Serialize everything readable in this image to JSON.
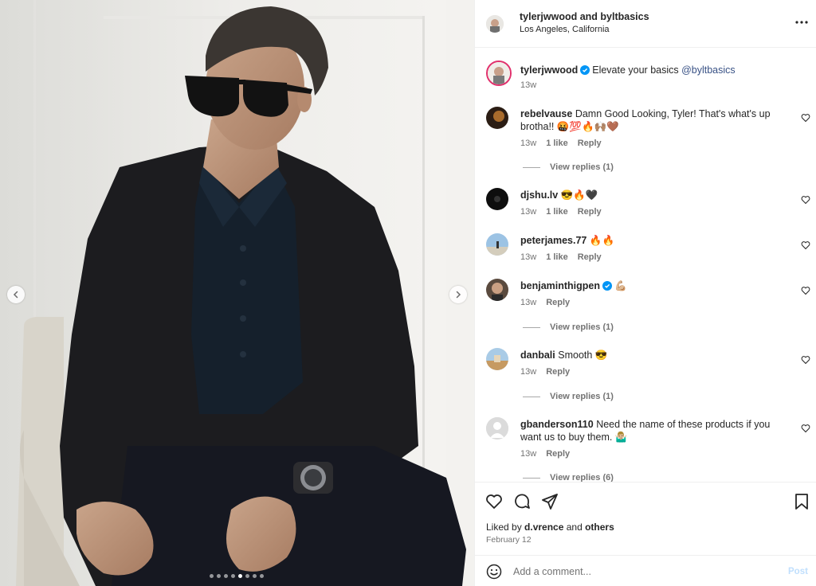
{
  "post": {
    "header": {
      "names": "tylerjwwood and byltbasics",
      "location": "Los Angeles, California"
    },
    "caption": {
      "user": "tylerjwwood",
      "text": "Elevate your basics ",
      "mention": "@byltbasics",
      "time": "13w"
    },
    "comments": [
      {
        "user": "rebelvause",
        "text": "Damn Good Looking, Tyler! That's what's up brotha!! 🤬💯🔥🙌🏽🤎",
        "time": "13w",
        "likes": "1 like",
        "reply": "Reply",
        "view_replies": "View replies (1)"
      },
      {
        "user": "djshu.lv",
        "text": "😎🔥🖤",
        "time": "13w",
        "likes": "1 like",
        "reply": "Reply"
      },
      {
        "user": "peterjames.77",
        "text": "🔥🔥",
        "time": "13w",
        "likes": "1 like",
        "reply": "Reply"
      },
      {
        "user": "benjaminthigpen",
        "text": "💪🏼",
        "time": "13w",
        "reply": "Reply",
        "view_replies": "View replies (1)"
      },
      {
        "user": "danbali",
        "text": "Smooth 😎",
        "time": "13w",
        "reply": "Reply",
        "view_replies": "View replies (1)"
      },
      {
        "user": "gbanderson110",
        "text": "Need the name of these products if you want us to buy them. 🤷🏼‍♂️",
        "time": "13w",
        "reply": "Reply",
        "view_replies": "View replies (6)"
      }
    ],
    "liked_prefix": "Liked by ",
    "liked_user": "d.vrence",
    "liked_and": " and ",
    "liked_others": "others",
    "date": "February 12",
    "add_comment_placeholder": "Add a comment...",
    "post_label": "Post",
    "carousel": {
      "total": 8,
      "active": 4
    }
  },
  "icons": {
    "more": "more-horizontal-icon",
    "prev": "chevron-left-icon",
    "next": "chevron-right-icon",
    "like": "heart-icon",
    "comment": "comment-icon",
    "share": "share-icon",
    "save": "bookmark-icon",
    "emoji": "emoji-icon",
    "verified": "verified-badge-icon"
  },
  "colors": {
    "link": "#385185",
    "secondary_text": "#737373",
    "verified": "#0095f6",
    "post_disabled": "#c0dffd"
  }
}
